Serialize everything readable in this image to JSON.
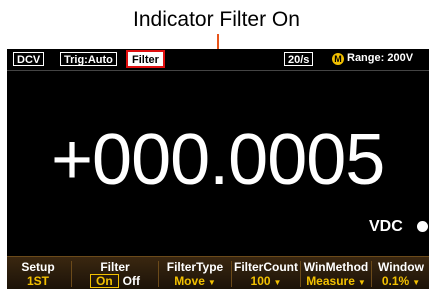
{
  "caption": "Indicator Filter On",
  "status": {
    "mode": "DCV",
    "trigger": "Trig:Auto",
    "filter": "Filter",
    "rate": "20/s",
    "range_icon": "M",
    "range": "Range:  200V"
  },
  "reading": {
    "value": "+000.0005",
    "unit": "VDC"
  },
  "softkeys": [
    {
      "title": "Setup",
      "value": "1ST"
    },
    {
      "title": "Filter",
      "on": "On",
      "off": "Off"
    },
    {
      "title": "FilterType",
      "value": "Move"
    },
    {
      "title": "FilterCount",
      "value": "100"
    },
    {
      "title": "WinMethod",
      "value": "Measure"
    },
    {
      "title": "Window",
      "value": "0.1%"
    }
  ],
  "colors": {
    "accent": "#f2c000",
    "highlight": "#e01010",
    "callout": "#e8541a"
  }
}
